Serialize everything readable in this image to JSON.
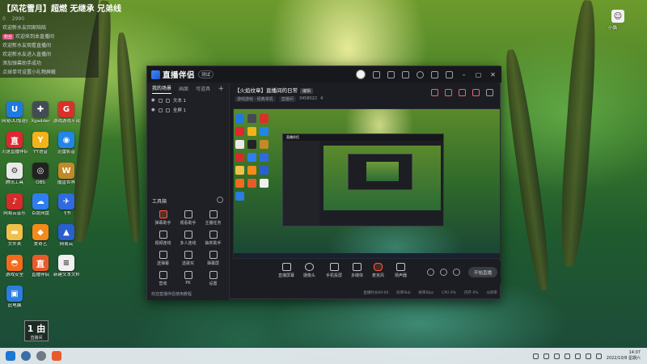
{
  "overlay": {
    "title": "【风花雪月】超燃 无继承 兄弟线",
    "stats": [
      "0",
      "2990"
    ],
    "lines": [
      "欢迎新水友回家陪陪",
      "欢迎来到本直播间",
      "欢迎新水友观看直播间",
      "欢迎新水友进入直播间",
      "添加弹幕助手成功",
      "点球单可设置小礼物屏蔽"
    ],
    "tag": "粉丝"
  },
  "desktop_icons": [
    {
      "label": "网易UU加速器",
      "icon": "uu-icon",
      "color": "#1f7ae0",
      "glyph": "U"
    },
    {
      "label": "Xgadder",
      "icon": "gamepad-icon",
      "color": "#444b56",
      "glyph": "✚"
    },
    {
      "label": "游戏游戏平台",
      "icon": "game-platform-icon",
      "color": "#d9302b",
      "glyph": "G"
    },
    {
      "label": "火速直播伴侣",
      "icon": "live-icon",
      "color": "#e0262e",
      "glyph": "直"
    },
    {
      "label": "YY语音",
      "icon": "yy-icon",
      "color": "#f2b31b",
      "glyph": "Y"
    },
    {
      "label": "迅雷影音",
      "icon": "xunlei-icon",
      "color": "#2186e8",
      "glyph": "◉"
    },
    {
      "label": "腾讯工具",
      "icon": "tool-icon",
      "color": "#e9e9e9",
      "glyph": "⚙"
    },
    {
      "label": "OBS",
      "icon": "obs-icon",
      "color": "#222",
      "glyph": "◎"
    },
    {
      "label": "魔兽世界",
      "icon": "warcraft-icon",
      "color": "#c08a2a",
      "glyph": "W"
    },
    {
      "label": "网易云音乐",
      "icon": "music-icon",
      "color": "#d72a2a",
      "glyph": "♪"
    },
    {
      "label": "百度网盘",
      "icon": "cloud-icon",
      "color": "#2f7df0",
      "glyph": "☁"
    },
    {
      "label": "飞书",
      "icon": "feishu-icon",
      "color": "#2f6ae0",
      "glyph": "✈"
    },
    {
      "label": "文件夹",
      "icon": "folder-icon",
      "color": "#f0c04a",
      "glyph": "▬"
    },
    {
      "label": "爱奇艺",
      "icon": "iqiyi-icon",
      "color": "#f38a1a",
      "glyph": "◆"
    },
    {
      "label": "网易云",
      "icon": "netease-icon",
      "color": "#2a5fd0",
      "glyph": "▲"
    },
    {
      "label": "游戏安全",
      "icon": "shield-icon",
      "color": "#f26b1d",
      "glyph": "◓"
    },
    {
      "label": "直播伴侣",
      "icon": "partner-icon",
      "color": "#e85a2a",
      "glyph": "直"
    },
    {
      "label": "新建文本文档",
      "icon": "document-icon",
      "color": "#f0f0f0",
      "glyph": "≡"
    },
    {
      "label": "此电脑",
      "icon": "computer-icon",
      "color": "#2b7de0",
      "glyph": "▣"
    }
  ],
  "bottom_widget": {
    "big": "1 由",
    "small": "直播间"
  },
  "corner_icon": {
    "label": "小猫"
  },
  "app": {
    "name": "直播伴侣",
    "version": "测试",
    "tabs": [
      "我的场景",
      "画面",
      "可道具"
    ],
    "sources": [
      "文本 1",
      "全屏 1"
    ],
    "tools_title": "工具箱",
    "tools": [
      {
        "label": "弹幕助手",
        "hot": true
      },
      {
        "label": "观看助手",
        "hot": false
      },
      {
        "label": "主播任务",
        "hot": false
      },
      {
        "label": "视频连线",
        "hot": false
      },
      {
        "label": "多人连线",
        "hot": false
      },
      {
        "label": "抽奖助手",
        "hot": false
      },
      {
        "label": "送弹幕",
        "hot": false
      },
      {
        "label": "选歌买",
        "hot": false
      },
      {
        "label": "弹幕屏",
        "hot": false
      },
      {
        "label": "营收",
        "hot": false
      },
      {
        "label": "PK",
        "hot": false
      },
      {
        "label": "设置",
        "hot": false
      }
    ],
    "left_footer": "欢迎直播伴侣使用教程",
    "room_title": "【火焰纹章】直播间的日常",
    "edit_label": "编辑",
    "room_meta": [
      "游戏游戏 · 经典单机",
      "直播间",
      "3458022",
      "4"
    ],
    "controls": [
      "直播屏幕",
      "摄像头",
      "手机投屏",
      "多媒体",
      "麦克风",
      "扬声器"
    ],
    "start_label": "开始直播",
    "status": [
      "直播时长00:00",
      "码率0kb",
      "帧率0fps",
      "CPU 0%",
      "内存 0%",
      "分辨率"
    ]
  },
  "taskbar": {
    "time": "14:07",
    "date": "2022/10/8 星期六"
  }
}
